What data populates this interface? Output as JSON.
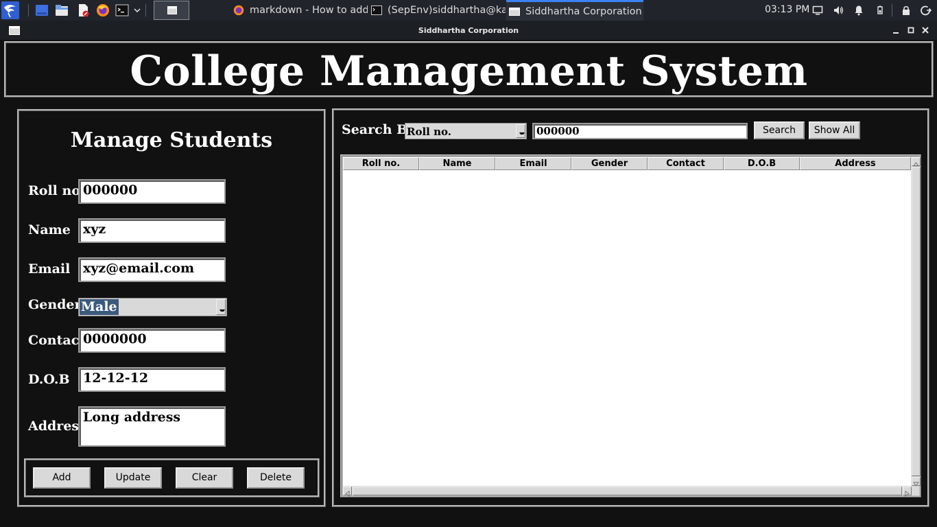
{
  "taskbar": {
    "tasks": [
      {
        "label": "markdown - How to add ...",
        "icon": "firefox-icon"
      },
      {
        "label": "(SepEnv)siddhartha@kal...",
        "icon": "terminal-icon"
      },
      {
        "label": "Siddhartha Corporation",
        "icon": "window-icon"
      }
    ],
    "clock": "03:13 PM"
  },
  "window": {
    "title": "Siddhartha Corporation"
  },
  "app": {
    "heading": "College Management System",
    "manage": {
      "title": "Manage Students",
      "fields": {
        "roll_label": "Roll no",
        "roll_value": "000000",
        "name_label": "Name",
        "name_value": "xyz",
        "email_label": "Email",
        "email_value": "xyz@email.com",
        "gender_label": "Gender",
        "gender_value": "Male",
        "contact_label": "Contact",
        "contact_value": "0000000",
        "dob_label": "D.O.B",
        "dob_value": "12-12-12",
        "address_label": "Address",
        "address_value": "Long address"
      },
      "buttons": {
        "add": "Add",
        "update": "Update",
        "clear": "Clear",
        "delete": "Delete"
      }
    },
    "search": {
      "label": "Search By",
      "by_value": "Roll no.",
      "query": "000000",
      "search_button": "Search",
      "show_all_button": "Show All"
    },
    "table": {
      "columns": [
        "Roll no.",
        "Name",
        "Email",
        "Gender",
        "Contact",
        "D.O.B",
        "Address"
      ],
      "rows": []
    }
  },
  "colors": {
    "background": "#111111",
    "taskbar": "#21252b",
    "widget": "#d9d9d9",
    "selection": "#3c5a7c"
  }
}
